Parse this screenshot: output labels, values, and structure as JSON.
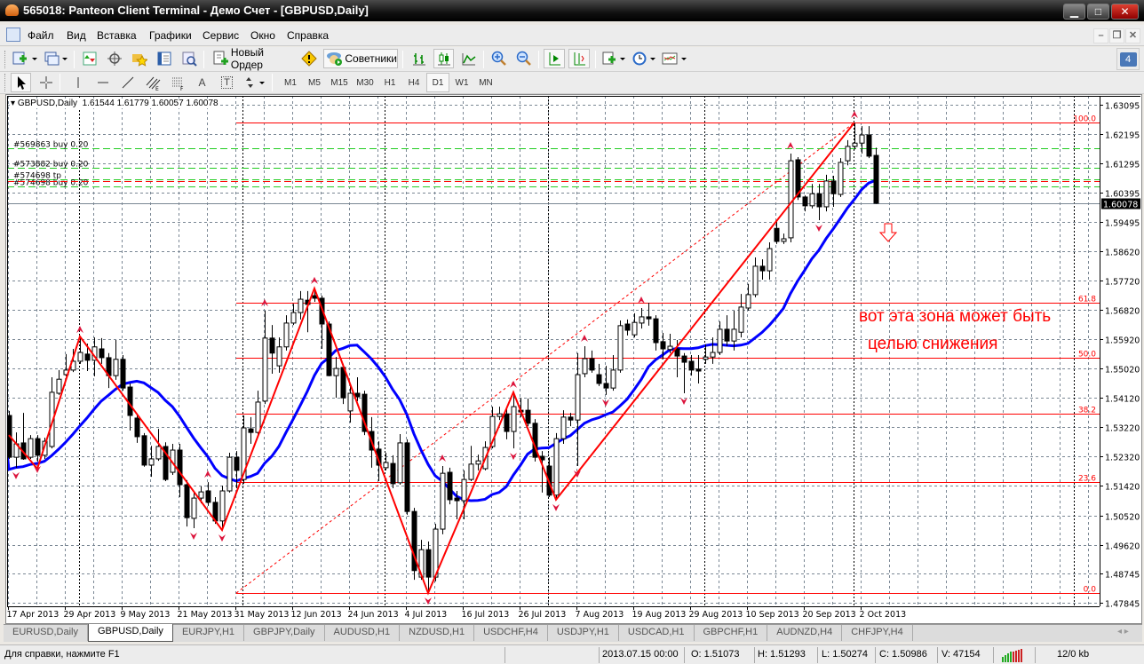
{
  "window": {
    "title": "565018: Panteon Client Terminal - Демо Счет - [GBPUSD,Daily]"
  },
  "menu": [
    "Файл",
    "Вид",
    "Вставка",
    "Графики",
    "Сервис",
    "Окно",
    "Справка"
  ],
  "toolbar": {
    "new_order": "Новый Ордер",
    "experts": "Советники",
    "timeframes": [
      "M1",
      "M5",
      "M15",
      "M30",
      "H1",
      "H4",
      "D1",
      "W1",
      "MN"
    ],
    "active_timeframe": "D1",
    "mail_count": "4",
    "text_tool": "A",
    "label_tool": "T"
  },
  "chart": {
    "symbol": "GBPUSD,Daily",
    "open": "1.61544",
    "high": "1.61779",
    "low": "1.60057",
    "close": "1.60078",
    "annotation_line1": "вот эта зона может быть",
    "annotation_line2": "целью снижения",
    "current_price": "1.60078"
  },
  "chart_data": {
    "type": "candlestick",
    "symbol": "GBPUSD",
    "timeframe": "Daily",
    "ylim": [
      1.47845,
      1.63095
    ],
    "price_ticks": [
      "1.63095",
      "1.62195",
      "1.61295",
      "1.60395",
      "1.59495",
      "1.58620",
      "1.57720",
      "1.56820",
      "1.55920",
      "1.55020",
      "1.54120",
      "1.53220",
      "1.52320",
      "1.51420",
      "1.50520",
      "1.49620",
      "1.48745",
      "1.47845"
    ],
    "date_labels": [
      {
        "bar": 0,
        "label": "17 Apr 2013"
      },
      {
        "bar": 8,
        "label": "29 Apr 2013"
      },
      {
        "bar": 16,
        "label": "9 May 2013"
      },
      {
        "bar": 24,
        "label": "21 May 2013"
      },
      {
        "bar": 32,
        "label": "31 May 2013"
      },
      {
        "bar": 40,
        "label": "12 Jun 2013"
      },
      {
        "bar": 48,
        "label": "24 Jun 2013"
      },
      {
        "bar": 56,
        "label": "4 Jul 2013"
      },
      {
        "bar": 64,
        "label": "16 Jul 2013"
      },
      {
        "bar": 72,
        "label": "26 Jul 2013"
      },
      {
        "bar": 80,
        "label": "7 Aug 2013"
      },
      {
        "bar": 88,
        "label": "19 Aug 2013"
      },
      {
        "bar": 96,
        "label": "29 Aug 2013"
      },
      {
        "bar": 104,
        "label": "10 Sep 2013"
      },
      {
        "bar": 112,
        "label": "20 Sep 2013"
      },
      {
        "bar": 120,
        "label": "2 Oct 2013"
      }
    ],
    "period_separators": [
      10,
      33,
      53,
      76,
      98,
      119,
      150
    ],
    "ohlc": [
      [
        1.5358,
        1.5372,
        1.5225,
        1.523
      ],
      [
        1.523,
        1.5306,
        1.5198,
        1.5271
      ],
      [
        1.5274,
        1.5366,
        1.5222,
        1.5225
      ],
      [
        1.523,
        1.5298,
        1.5225,
        1.5287
      ],
      [
        1.5287,
        1.5298,
        1.5217,
        1.5236
      ],
      [
        1.5236,
        1.529,
        1.5225,
        1.5279
      ],
      [
        1.5263,
        1.5475,
        1.5257,
        1.5429
      ],
      [
        1.5426,
        1.5497,
        1.5421,
        1.5469
      ],
      [
        1.5483,
        1.5546,
        1.5478,
        1.5497
      ],
      [
        1.5497,
        1.5562,
        1.5491,
        1.5524
      ],
      [
        1.5524,
        1.5597,
        1.5516,
        1.5551
      ],
      [
        1.5546,
        1.5578,
        1.5494,
        1.5527
      ],
      [
        1.5527,
        1.5597,
        1.5478,
        1.5568
      ],
      [
        1.5562,
        1.5595,
        1.5516,
        1.5535
      ],
      [
        1.5535,
        1.5549,
        1.5442,
        1.548
      ],
      [
        1.548,
        1.5589,
        1.5467,
        1.553
      ],
      [
        1.553,
        1.5543,
        1.5434,
        1.5442
      ],
      [
        1.5445,
        1.5456,
        1.5312,
        1.5358
      ],
      [
        1.535,
        1.5358,
        1.5274,
        1.5293
      ],
      [
        1.5296,
        1.5304,
        1.5201,
        1.5206
      ],
      [
        1.5206,
        1.5265,
        1.517,
        1.5225
      ],
      [
        1.5225,
        1.5317,
        1.5219,
        1.5263
      ],
      [
        1.5263,
        1.5276,
        1.5157,
        1.5162
      ],
      [
        1.5184,
        1.5271,
        1.5176,
        1.5252
      ],
      [
        1.5252,
        1.5271,
        1.5108,
        1.5146
      ],
      [
        1.5146,
        1.516,
        1.5018,
        1.5045
      ],
      [
        1.5043,
        1.5122,
        1.5013,
        1.5105
      ],
      [
        1.5105,
        1.5141,
        1.5089,
        1.5124
      ],
      [
        1.5127,
        1.5154,
        1.5081,
        1.5092
      ],
      [
        1.5092,
        1.5108,
        1.5026,
        1.5035
      ],
      [
        1.5035,
        1.5143,
        1.5007,
        1.5127
      ],
      [
        1.5127,
        1.5244,
        1.5122,
        1.523
      ],
      [
        1.523,
        1.5249,
        1.5135,
        1.519
      ],
      [
        1.5162,
        1.5358,
        1.5149,
        1.532
      ],
      [
        1.5317,
        1.5353,
        1.5271,
        1.5306
      ],
      [
        1.5306,
        1.5434,
        1.5298,
        1.5399
      ],
      [
        1.5402,
        1.5679,
        1.5393,
        1.5595
      ],
      [
        1.5595,
        1.5635,
        1.5486,
        1.5549
      ],
      [
        1.551,
        1.5597,
        1.5489,
        1.5568
      ],
      [
        1.5568,
        1.5665,
        1.5557,
        1.5641
      ],
      [
        1.5641,
        1.57,
        1.5635,
        1.5673
      ],
      [
        1.5673,
        1.5739,
        1.5652,
        1.5714
      ],
      [
        1.5711,
        1.5739,
        1.5613,
        1.5698
      ],
      [
        1.5725,
        1.5747,
        1.5706,
        1.5717
      ],
      [
        1.5717,
        1.5725,
        1.5562,
        1.5638
      ],
      [
        1.5638,
        1.5646,
        1.5478,
        1.548
      ],
      [
        1.548,
        1.5537,
        1.5412,
        1.5502
      ],
      [
        1.5505,
        1.5516,
        1.5393,
        1.5412
      ],
      [
        1.5372,
        1.5448,
        1.5336,
        1.5426
      ],
      [
        1.5426,
        1.5475,
        1.5402,
        1.5415
      ],
      [
        1.5423,
        1.5434,
        1.5298,
        1.5309
      ],
      [
        1.5309,
        1.5353,
        1.5198,
        1.5252
      ],
      [
        1.5255,
        1.5279,
        1.5157,
        1.5206
      ],
      [
        1.5198,
        1.5244,
        1.519,
        1.5214
      ],
      [
        1.5211,
        1.5236,
        1.5135,
        1.5149
      ],
      [
        1.5152,
        1.5301,
        1.5146,
        1.5274
      ],
      [
        1.5274,
        1.5285,
        1.5054,
        1.5064
      ],
      [
        1.5064,
        1.5075,
        1.4855,
        1.4883
      ],
      [
        1.4863,
        1.4977,
        1.4855,
        1.4947
      ],
      [
        1.4947,
        1.4972,
        1.4814,
        1.4863
      ],
      [
        1.4863,
        1.5026,
        1.485,
        1.501
      ],
      [
        1.501,
        1.5203,
        1.4994,
        1.5181
      ],
      [
        1.5184,
        1.5198,
        1.5086,
        1.51
      ],
      [
        1.5105,
        1.5127,
        1.504,
        1.5097
      ],
      [
        1.5097,
        1.519,
        1.504,
        1.5162
      ],
      [
        1.5162,
        1.5265,
        1.5157,
        1.5209
      ],
      [
        1.5209,
        1.5238,
        1.519,
        1.5219
      ],
      [
        1.5195,
        1.5279,
        1.519,
        1.526
      ],
      [
        1.5263,
        1.5385,
        1.5257,
        1.5355
      ],
      [
        1.5355,
        1.5385,
        1.5344,
        1.5363
      ],
      [
        1.5363,
        1.538,
        1.5285,
        1.5309
      ],
      [
        1.5309,
        1.5429,
        1.5257,
        1.5385
      ],
      [
        1.5374,
        1.5412,
        1.5353,
        1.5369
      ],
      [
        1.5374,
        1.541,
        1.5325,
        1.5334
      ],
      [
        1.5334,
        1.5347,
        1.5217,
        1.523
      ],
      [
        1.5233,
        1.5249,
        1.5122,
        1.5222
      ],
      [
        1.5203,
        1.523,
        1.5108,
        1.5114
      ],
      [
        1.5114,
        1.5304,
        1.51,
        1.5287
      ],
      [
        1.5287,
        1.5374,
        1.5271,
        1.5353
      ],
      [
        1.5353,
        1.5366,
        1.5325,
        1.5344
      ],
      [
        1.5344,
        1.5549,
        1.5203,
        1.5483
      ],
      [
        1.5486,
        1.557,
        1.5475,
        1.5532
      ],
      [
        1.5532,
        1.5557,
        1.5489,
        1.5497
      ],
      [
        1.5483,
        1.5516,
        1.5448,
        1.5456
      ],
      [
        1.5456,
        1.551,
        1.5421,
        1.5442
      ],
      [
        1.5442,
        1.5543,
        1.5434,
        1.5497
      ],
      [
        1.5497,
        1.5649,
        1.5489,
        1.5633
      ],
      [
        1.5638,
        1.5652,
        1.5603,
        1.5619
      ],
      [
        1.5605,
        1.5671,
        1.5597,
        1.5643
      ],
      [
        1.5641,
        1.5687,
        1.5624,
        1.566
      ],
      [
        1.566,
        1.5703,
        1.5633,
        1.5654
      ],
      [
        1.5654,
        1.5665,
        1.5557,
        1.5581
      ],
      [
        1.5584,
        1.5611,
        1.553,
        1.5562
      ],
      [
        1.556,
        1.5608,
        1.5549,
        1.557
      ],
      [
        1.5562,
        1.5589,
        1.5475,
        1.554
      ],
      [
        1.554,
        1.5549,
        1.5426,
        1.5521
      ],
      [
        1.5524,
        1.5543,
        1.548,
        1.5497
      ],
      [
        1.55,
        1.5543,
        1.5456,
        1.5494
      ],
      [
        1.553,
        1.5576,
        1.5516,
        1.5537
      ],
      [
        1.5537,
        1.5597,
        1.5516,
        1.5551
      ],
      [
        1.5551,
        1.5646,
        1.5543,
        1.5622
      ],
      [
        1.5622,
        1.5665,
        1.557,
        1.5586
      ],
      [
        1.5586,
        1.5679,
        1.5557,
        1.5622
      ],
      [
        1.5613,
        1.573,
        1.5597,
        1.569
      ],
      [
        1.5687,
        1.5761,
        1.5679,
        1.5728
      ],
      [
        1.5728,
        1.5842,
        1.572,
        1.5815
      ],
      [
        1.5815,
        1.5836,
        1.5774,
        1.5801
      ],
      [
        1.5801,
        1.5888,
        1.5774,
        1.5869
      ],
      [
        1.5931,
        1.5951,
        1.5883,
        1.5891
      ],
      [
        1.5891,
        1.5915,
        1.5883,
        1.5899
      ],
      [
        1.5902,
        1.616,
        1.5888,
        1.6138
      ],
      [
        1.6141,
        1.6149,
        1.6018,
        1.6027
      ],
      [
        1.6027,
        1.6032,
        1.5983,
        1.6
      ],
      [
        1.6,
        1.6067,
        1.5992,
        1.6037
      ],
      [
        1.6037,
        1.6067,
        1.5956,
        1.5997
      ],
      [
        1.5997,
        1.6095,
        1.5983,
        1.6076
      ],
      [
        1.6076,
        1.6092,
        1.5997,
        1.6037
      ],
      [
        1.6035,
        1.6146,
        1.6027,
        1.6133
      ],
      [
        1.6138,
        1.6201,
        1.6124,
        1.6182
      ],
      [
        1.6182,
        1.6255,
        1.6173,
        1.6192
      ],
      [
        1.6192,
        1.6244,
        1.616,
        1.6217
      ],
      [
        1.6217,
        1.6244,
        1.6146,
        1.6152
      ],
      [
        1.61544,
        1.61779,
        1.60057,
        1.60078
      ]
    ],
    "zigzag": [
      [
        0,
        1.5298
      ],
      [
        4,
        1.5195
      ],
      [
        10,
        1.56
      ],
      [
        30,
        1.5007
      ],
      [
        43,
        1.5747
      ],
      [
        59,
        1.4814
      ],
      [
        71,
        1.5429
      ],
      [
        77,
        1.51
      ],
      [
        119,
        1.6255
      ]
    ],
    "fractals_up": [
      10,
      28,
      36,
      43,
      61,
      71,
      81,
      89,
      110,
      119
    ],
    "fractals_down": [
      1,
      4,
      26,
      30,
      59,
      71,
      77,
      80,
      84,
      95,
      114
    ],
    "fibonacci": {
      "from_bar": 32,
      "to_bar": 119,
      "low": 1.4814,
      "high": 1.6255,
      "levels": [
        {
          "ratio": 0,
          "label": "0.0"
        },
        {
          "ratio": 0.236,
          "label": "23.6"
        },
        {
          "ratio": 0.382,
          "label": "38.2"
        },
        {
          "ratio": 0.5,
          "label": "50.0"
        },
        {
          "ratio": 0.618,
          "label": "61.8"
        },
        {
          "ratio": 1,
          "label": "100.0"
        }
      ]
    },
    "orders": [
      {
        "label": "#569863 buy 0.20",
        "price": 1.6176,
        "kind": "buy"
      },
      {
        "label": "#573882 buy 0.20",
        "price": 1.6116,
        "kind": "buy"
      },
      {
        "label": "#574698 tp",
        "price": 1.6081,
        "kind": "tp"
      },
      {
        "label": "#574698 buy 0.20",
        "price": 1.6059,
        "kind": "buy"
      }
    ],
    "stop_line": 1.6075,
    "moving_average_color": "#0000ff",
    "zigzag_color": "#ff0000",
    "fib_color": "#ff0000",
    "order_color": "#22cc22",
    "fractal_color": "#dc143c"
  },
  "tabs": [
    {
      "label": "EURUSD,Daily",
      "active": false
    },
    {
      "label": "GBPUSD,Daily",
      "active": true
    },
    {
      "label": "EURJPY,H1",
      "active": false
    },
    {
      "label": "GBPJPY,Daily",
      "active": false
    },
    {
      "label": "AUDUSD,H1",
      "active": false
    },
    {
      "label": "NZDUSD,H1",
      "active": false
    },
    {
      "label": "USDCHF,H4",
      "active": false
    },
    {
      "label": "USDJPY,H1",
      "active": false
    },
    {
      "label": "USDCAD,H1",
      "active": false
    },
    {
      "label": "GBPCHF,H1",
      "active": false
    },
    {
      "label": "AUDNZD,H4",
      "active": false
    },
    {
      "label": "CHFJPY,H4",
      "active": false
    }
  ],
  "status": {
    "help": "Для справки, нажмите F1",
    "datetime": "2013.07.15 00:00",
    "open": "O: 1.51073",
    "high": "H: 1.51293",
    "low": "L: 1.50274",
    "close": "C: 1.50986",
    "volume": "V: 47154",
    "traffic": "12/0 kb"
  }
}
